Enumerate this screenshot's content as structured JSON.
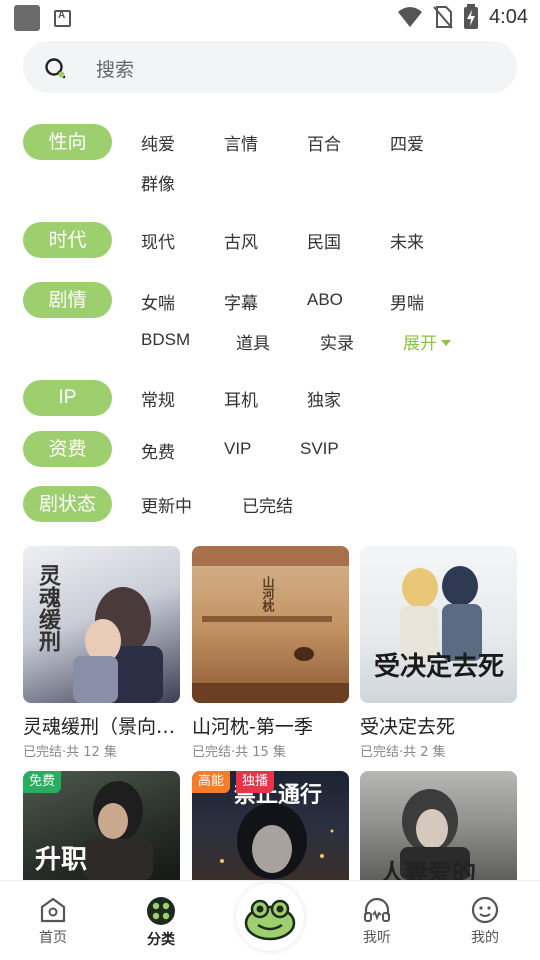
{
  "status_bar": {
    "time": "4:04"
  },
  "search": {
    "placeholder": "搜索"
  },
  "filters": {
    "orientation": {
      "label": "性向",
      "options": [
        "纯爱",
        "言情",
        "百合",
        "四爱",
        "群像"
      ]
    },
    "era": {
      "label": "时代",
      "options": [
        "现代",
        "古风",
        "民国",
        "未来"
      ]
    },
    "plot": {
      "label": "剧情",
      "options": [
        "女喘",
        "字幕",
        "ABO",
        "男喘",
        "BDSM",
        "道具",
        "实录"
      ],
      "expand_label": "展开"
    },
    "ip": {
      "label": "IP",
      "options": [
        "常规",
        "耳机",
        "独家"
      ]
    },
    "fee": {
      "label": "资费",
      "options": [
        "免费",
        "VIP",
        "SVIP"
      ]
    },
    "status": {
      "label": "剧状态",
      "options": [
        "更新中",
        "已完结"
      ]
    }
  },
  "cards": [
    {
      "title": "灵魂缓刑（景向…",
      "meta": "已完结·共 12 集",
      "cover_text": "灵魂缓刑"
    },
    {
      "title": "山河枕-第一季",
      "meta": "已完结·共 15 集",
      "cover_text": "山河枕"
    },
    {
      "title": "受决定去死",
      "meta": "已完结·共 2 集",
      "cover_text": "受决定去死"
    },
    {
      "tag": "免费",
      "cover_text": "升职"
    },
    {
      "tags": [
        "高能",
        "独播"
      ],
      "cover_text": "禁止通行"
    },
    {
      "cover_text": "人妻爱的"
    }
  ],
  "bottom_nav": {
    "home": "首页",
    "category": "分类",
    "listen": "我听",
    "mine": "我的"
  },
  "colors": {
    "accent": "#9dcf6e",
    "expand": "#8bc34a",
    "tag_free": "#27ae60",
    "tag_high": "#f57c2b",
    "tag_exclusive": "#e8344a"
  }
}
